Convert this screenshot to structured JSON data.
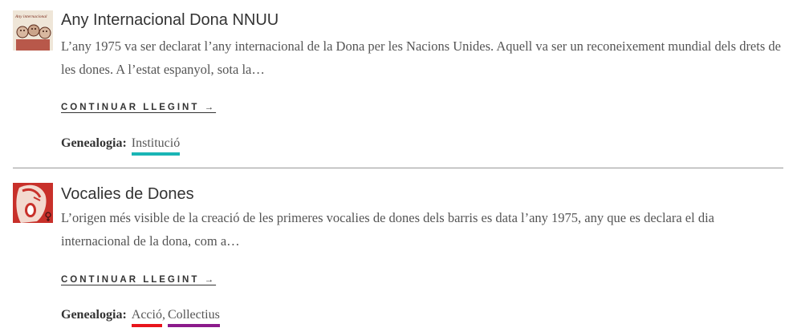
{
  "entries": [
    {
      "title": "Any Internacional Dona NNUU",
      "excerpt": "L’any 1975 va ser declarat l’any internacional de la Dona per les Nacions Unides. Aquell va ser un reconeixement mundial dels drets de les dones. A l’estat espanyol, sota la…",
      "read_more": "CONTINUAR LLEGINT →",
      "genealogy_label": "Genealogia:",
      "tags": [
        {
          "label": "Institució",
          "color": "#1ab5b5"
        }
      ],
      "thumbnail_text": "Any internacional"
    },
    {
      "title": "Vocalies de Dones",
      "excerpt": "L’origen més visible de la creació de les primeres vocalies de dones dels barris es data l’any 1975, any que es declara el dia internacional de la dona, com a…",
      "read_more": "CONTINUAR LLEGINT →",
      "genealogy_label": "Genealogia:",
      "tags": [
        {
          "label": "Acció",
          "color": "#e8141b"
        },
        {
          "label": "Collectius",
          "color": "#8b1a8b"
        }
      ]
    }
  ],
  "tag_separator": ","
}
